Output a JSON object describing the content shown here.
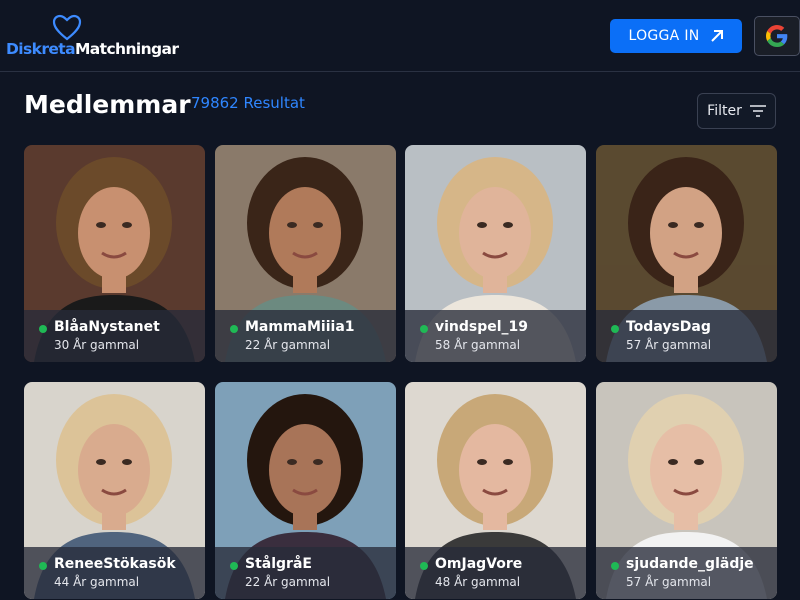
{
  "header": {
    "logo": {
      "part1": "Diskreta",
      "part2": "Matchningar"
    },
    "login_label": "LOGGA IN",
    "google_icon": "google-icon"
  },
  "main": {
    "title": "Medlemmar",
    "result_count": "79862 Resultat",
    "filter_label": "Filter"
  },
  "members": [
    {
      "name": "BlåaNystanet",
      "age": "30 År gammal",
      "online": true,
      "bg": "#5a3a2e",
      "skin": "#c89070",
      "hair": "#6b4a2a",
      "top": "#1a1a1a"
    },
    {
      "name": "MammaMiiia1",
      "age": "22 År gammal",
      "online": true,
      "bg": "#8a7a6a",
      "skin": "#b07a5a",
      "hair": "#3a2518",
      "top": "#6c8a80"
    },
    {
      "name": "vindspel_19",
      "age": "58 År gammal",
      "online": true,
      "bg": "#b9bfc4",
      "skin": "#e0b49a",
      "hair": "#d6b688",
      "top": "#ece6dc"
    },
    {
      "name": "TodaysDag",
      "age": "57 År gammal",
      "online": true,
      "bg": "#5a4a30",
      "skin": "#d2a284",
      "hair": "#3a2418",
      "top": "#8a9aa8"
    },
    {
      "name": "ReneeStökasök",
      "age": "44 År gammal",
      "online": true,
      "bg": "#d8d4cc",
      "skin": "#d9ab8e",
      "hair": "#dcc398",
      "top": "#50647e"
    },
    {
      "name": "StålgråE",
      "age": "22 År gammal",
      "online": true,
      "bg": "#7ea0b8",
      "skin": "#a87458",
      "hair": "#24160e",
      "top": "#3a2e3e"
    },
    {
      "name": "OmJagVore",
      "age": "48 År gammal",
      "online": true,
      "bg": "#ddd8d0",
      "skin": "#e4b8a0",
      "hair": "#c8a878",
      "top": "#3a3a3a"
    },
    {
      "name": "sjudande_glädje",
      "age": "57 År gammal",
      "online": true,
      "bg": "#c8c4bc",
      "skin": "#e6bea6",
      "hair": "#e0d0b0",
      "top": "#f2f2f2"
    }
  ]
}
